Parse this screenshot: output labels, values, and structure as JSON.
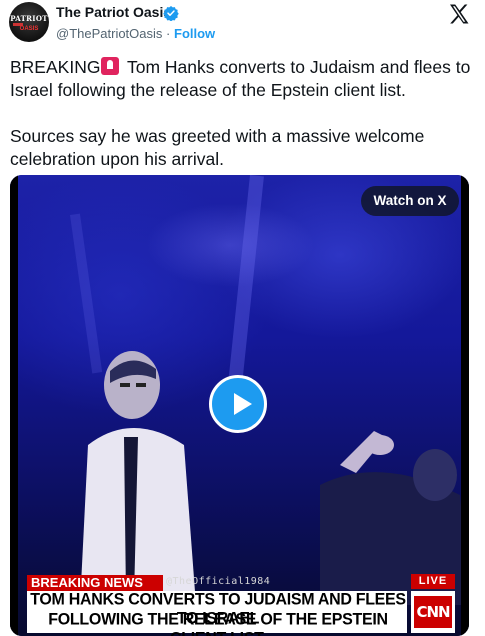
{
  "account": {
    "name": "The Patriot Oasis",
    "handle": "@ThePatriotOasis",
    "separator": "·",
    "follow_label": "Follow",
    "avatar_text_top": "PATRIOT",
    "avatar_text_bottom": "OASIS"
  },
  "icons": {
    "verified": "verified-badge-icon",
    "platform": "x-logo-icon",
    "siren": "police-light-icon",
    "play": "play-icon"
  },
  "tweet": {
    "line1_prefix": "BREAKING",
    "line1_suffix": " Tom Hanks converts to Judaism and flees to Israel following the release of the Epstein client list.",
    "paragraph2": "Sources say he was greeted with a massive welcome celebration upon his arrival."
  },
  "media": {
    "watch_label": "Watch on X",
    "chyron_tag": "BREAKING NEWS",
    "watermark": "@TheOfficial1984",
    "headline_line1": "TOM HANKS CONVERTS TO JUDAISM AND FLEES TO ISRAEL",
    "headline_line2": "FOLLOWING THE RELEASE OF THE EPSTEIN CLIENT LIST.",
    "live_label": "LIVE",
    "network_logo": "CNN"
  },
  "colors": {
    "accent": "#1d9bf0",
    "text": "#0f1419",
    "muted": "#536471",
    "news_red": "#cc0000"
  }
}
